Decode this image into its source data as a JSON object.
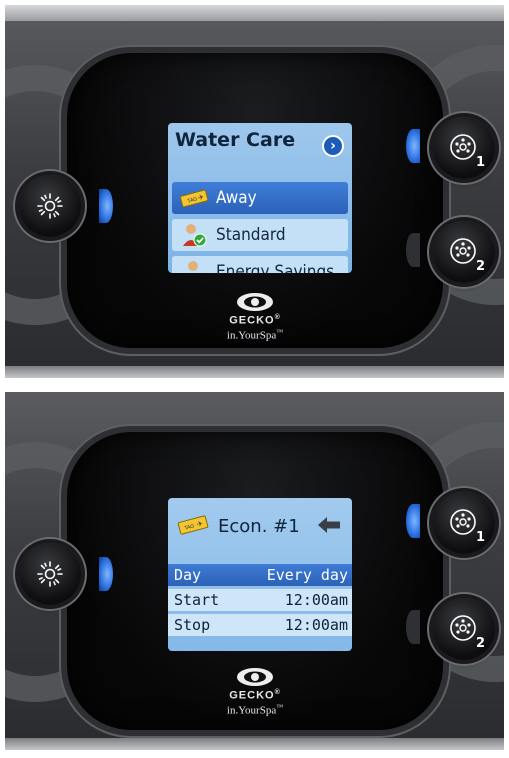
{
  "panel_top": {
    "screen": {
      "title": "Water Care",
      "next_icon": "chevron-right-circle-icon",
      "items": [
        {
          "label": "Away",
          "icon": "ticket-icon",
          "selected": true
        },
        {
          "label": "Standard",
          "icon": "person-check-icon",
          "selected": false
        },
        {
          "label": "Energy Savings",
          "icon": "person-icon",
          "selected": false
        }
      ]
    },
    "left_button_icon": "light-icon",
    "right_buttons": [
      {
        "icon": "pump-icon",
        "number": "1"
      },
      {
        "icon": "pump-icon",
        "number": "2"
      }
    ],
    "logo": {
      "brand": "GECKO",
      "reg": "®",
      "tagline": "in.YourSpa",
      "tm": "™"
    }
  },
  "panel_bottom": {
    "screen": {
      "title": "Econ. #1",
      "ticket_icon": "ticket-icon",
      "back_icon": "back-arrow-icon",
      "rows": [
        {
          "label": "Day",
          "value": "Every day",
          "selected": true
        },
        {
          "label": "Start",
          "value": "12:00am",
          "selected": false
        },
        {
          "label": "Stop",
          "value": "12:00am",
          "selected": false
        }
      ]
    },
    "left_button_icon": "light-icon",
    "right_buttons": [
      {
        "icon": "pump-icon",
        "number": "1"
      },
      {
        "icon": "pump-icon",
        "number": "2"
      }
    ],
    "logo": {
      "brand": "GECKO",
      "reg": "®",
      "tagline": "in.YourSpa",
      "tm": "™"
    }
  },
  "colors": {
    "screen_bg": "#8dbde9",
    "selected_row": "#2f66bb",
    "normal_row": "#c8e2f7",
    "indicator_blue": "#2a6fe0"
  }
}
